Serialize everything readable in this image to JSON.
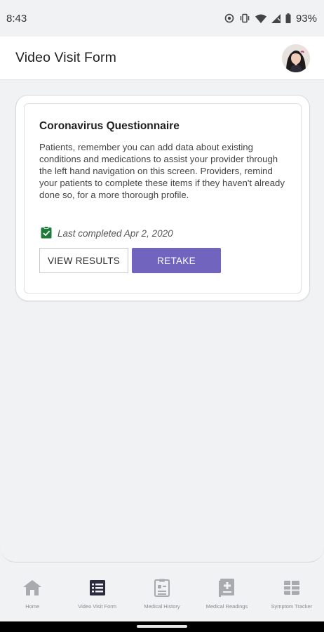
{
  "status_bar": {
    "time": "8:43",
    "battery": "93%",
    "icons": [
      "sync-icon",
      "vibrate-icon",
      "wifi-icon",
      "signal-icon",
      "battery-icon"
    ]
  },
  "app_bar": {
    "title": "Video Visit Form",
    "avatar_icon": "user-avatar"
  },
  "questionnaire_card": {
    "title": "Coronavirus Questionnaire",
    "description": "Patients, remember you can add data about existing conditions and medications to assist your provider through the left hand navigation on this screen. Providers, remind your patients to complete these items if they haven't already done so, for a more thorough profile.",
    "completed_icon": "checked-clipboard-icon",
    "last_completed": "Last completed Apr 2, 2020",
    "view_results_label": "VIEW RESULTS",
    "retake_label": "RETAKE"
  },
  "bottom_nav": {
    "items": [
      {
        "label": "Home",
        "icon": "home-icon",
        "active": false
      },
      {
        "label": "Video Visit Form",
        "icon": "form-icon",
        "active": true
      },
      {
        "label": "Medical History",
        "icon": "clipboard-icon",
        "active": false
      },
      {
        "label": "Medical Readings",
        "icon": "medical-book-icon",
        "active": false
      },
      {
        "label": "Symptom Tracker",
        "icon": "table-icon",
        "active": false
      }
    ]
  },
  "colors": {
    "accent": "#7064bf",
    "check_green": "#1e7a3a",
    "background": "#f1f2f4",
    "nav_active": "#2b2a3f",
    "nav_inactive": "#a9aaae"
  }
}
